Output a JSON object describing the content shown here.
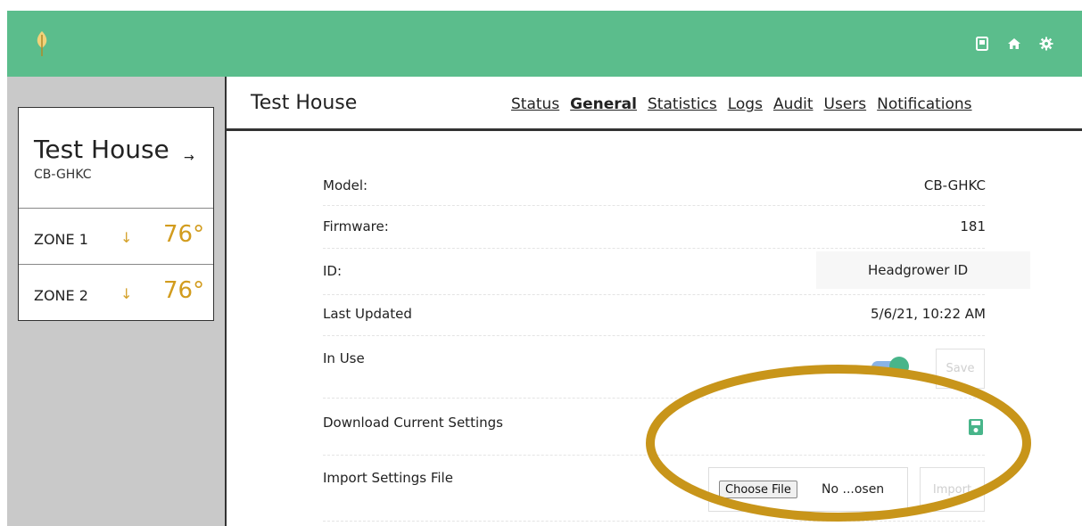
{
  "header": {
    "icons": [
      "leaf-logo-icon",
      "save-icon",
      "home-icon",
      "gear-icon"
    ],
    "bg_color": "#5bbd8c"
  },
  "sidebar": {
    "card": {
      "title": "Test House",
      "arrow": "→",
      "subtitle": "CB-GHKC"
    },
    "zones": [
      {
        "name": "ZONE 1",
        "arrow": "↓",
        "temp": "76°"
      },
      {
        "name": "ZONE 2",
        "arrow": "↓",
        "temp": "76°"
      }
    ]
  },
  "main": {
    "title": "Test House",
    "tabs": [
      {
        "label": "Status",
        "active": false
      },
      {
        "label": "General",
        "active": true
      },
      {
        "label": "Statistics",
        "active": false
      },
      {
        "label": "Logs",
        "active": false
      },
      {
        "label": "Audit",
        "active": false
      },
      {
        "label": "Users",
        "active": false
      },
      {
        "label": "Notifications",
        "active": false
      }
    ],
    "rows": {
      "model": {
        "label": "Model:",
        "value": "CB-GHKC"
      },
      "firmware": {
        "label": "Firmware:",
        "value": "181"
      },
      "id": {
        "label": "ID:",
        "value": "Headgrower ID"
      },
      "updated": {
        "label": "Last Updated",
        "value": "5/6/21, 10:22 AM"
      },
      "in_use": {
        "label": "In Use",
        "toggle_on": true,
        "save_label": "Save"
      },
      "download": {
        "label": "Download Current Settings"
      },
      "import": {
        "label": "Import Settings File",
        "choose_label": "Choose File",
        "file_status": "No ...osen",
        "import_label": "Import"
      }
    }
  },
  "colors": {
    "accent": "#5bbd8c",
    "temp": "#d29c1e",
    "highlight_ellipse": "#c8951a"
  }
}
